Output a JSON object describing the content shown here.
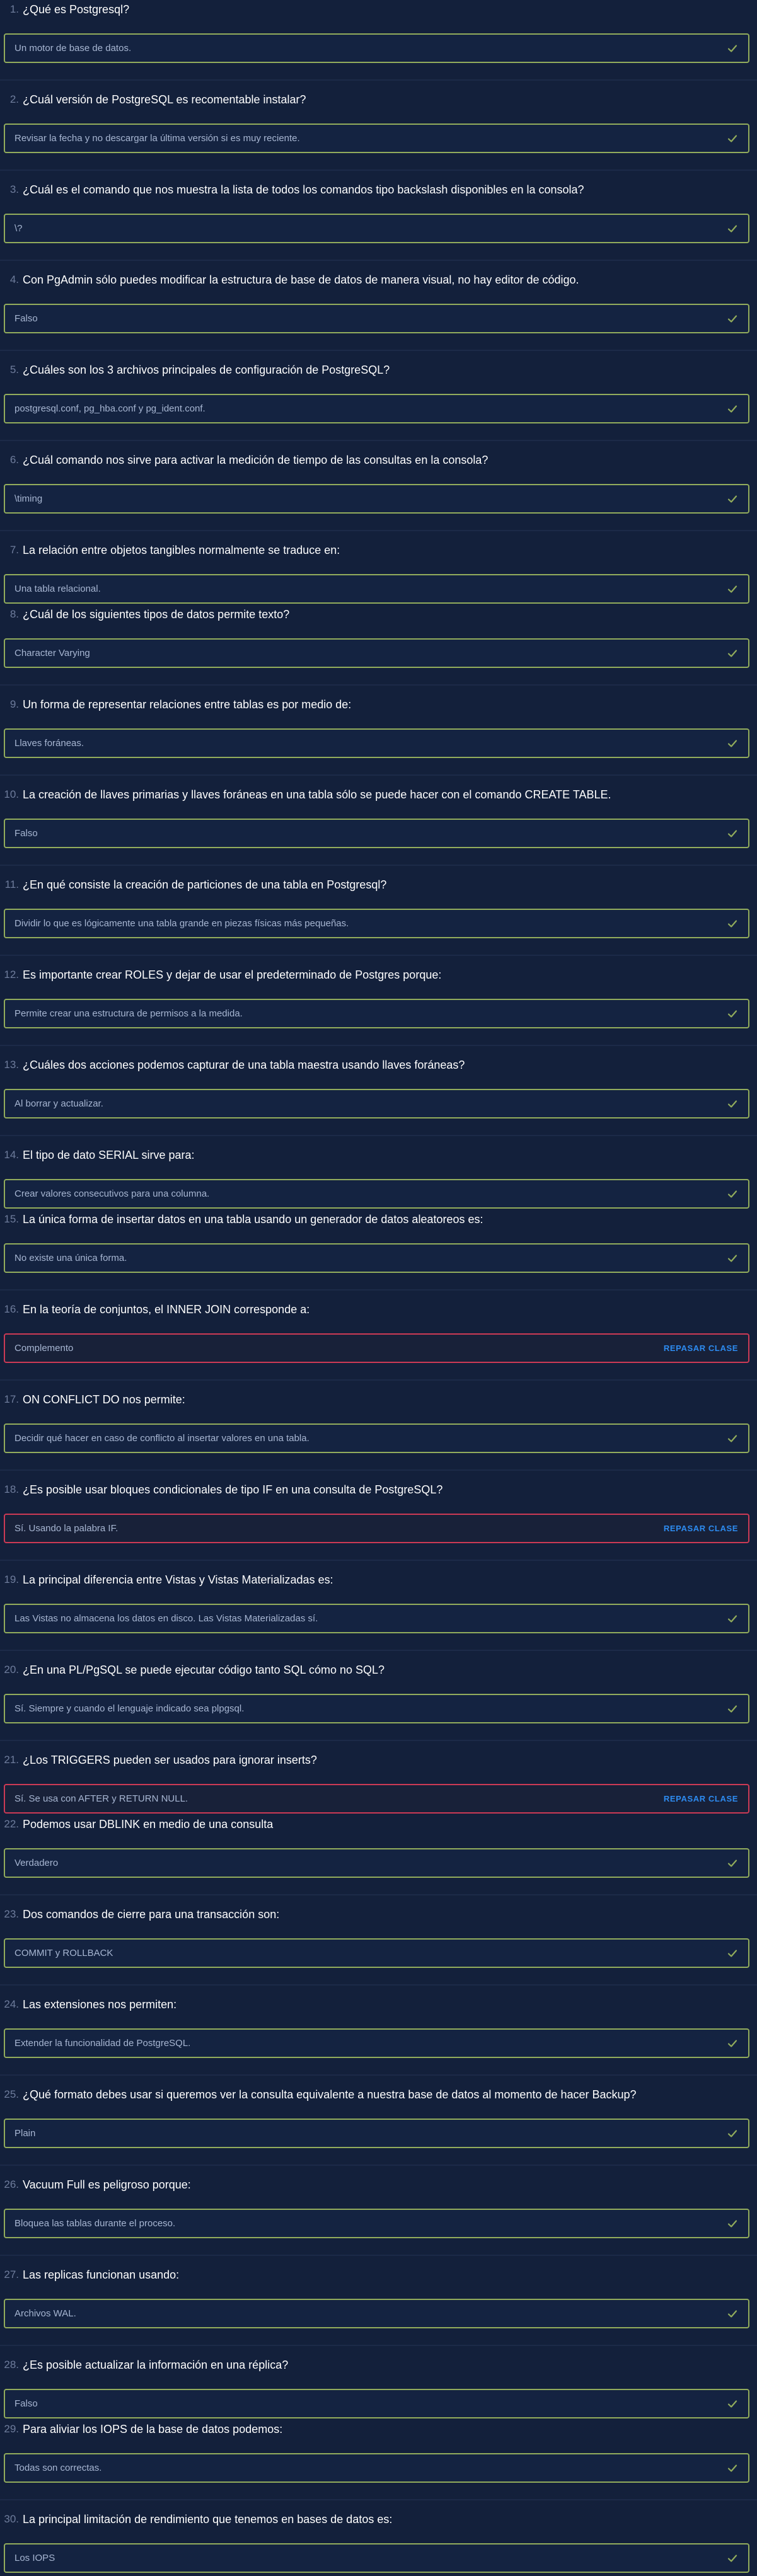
{
  "questions": [
    {
      "number": "1.",
      "question": "¿Qué es Postgresql?",
      "answer": "Un motor de base de datos.",
      "status": "correct"
    },
    {
      "number": "2.",
      "question": "¿Cuál versión de PostgreSQL es recomentable instalar?",
      "answer": "Revisar la fecha y no descargar la última versión si es muy reciente.",
      "status": "correct"
    },
    {
      "number": "3.",
      "question": "¿Cuál es el comando que nos muestra la lista de todos los comandos tipo backslash disponibles en la consola?",
      "answer": "\\?",
      "status": "correct"
    },
    {
      "number": "4.",
      "question": "Con PgAdmin sólo puedes modificar la estructura de base de datos de manera visual, no hay editor de código.",
      "answer": "Falso",
      "status": "correct"
    },
    {
      "number": "5.",
      "question": "¿Cuáles son los 3 archivos principales de configuración de PostgreSQL?",
      "answer": "postgresql.conf, pg_hba.conf y pg_ident.conf.",
      "status": "correct"
    },
    {
      "number": "6.",
      "question": "¿Cuál comando nos sirve para activar la medición de tiempo de las consultas en la consola?",
      "answer": "\\timing",
      "status": "correct"
    },
    {
      "number": "7.",
      "question": "La relación entre objetos tangibles normalmente se traduce en:",
      "answer": "Una tabla relacional.",
      "status": "correct"
    },
    {
      "number": "8.",
      "question": "¿Cuál de los siguientes tipos de datos permite texto?",
      "answer": "Character Varying",
      "status": "correct"
    },
    {
      "number": "9.",
      "question": "Un forma de representar relaciones entre tablas es por medio de:",
      "answer": "Llaves foráneas.",
      "status": "correct"
    },
    {
      "number": "10.",
      "question": "La creación de llaves primarias y llaves foráneas en una tabla sólo se puede hacer con el comando CREATE TABLE.",
      "answer": "Falso",
      "status": "correct"
    },
    {
      "number": "11.",
      "question": "¿En qué consiste la creación de particiones de una tabla en Postgresql?",
      "answer": "Dividir lo que es lógicamente una tabla grande en piezas físicas más pequeñas.",
      "status": "correct"
    },
    {
      "number": "12.",
      "question": "Es importante crear ROLES y dejar de usar el predeterminado de Postgres porque:",
      "answer": "Permite crear una estructura de permisos a la medida.",
      "status": "correct"
    },
    {
      "number": "13.",
      "question": "¿Cuáles dos acciones podemos capturar de una tabla maestra usando llaves foráneas?",
      "answer": "Al borrar y actualizar.",
      "status": "correct"
    },
    {
      "number": "14.",
      "question": "El tipo de dato SERIAL sirve para:",
      "answer": "Crear valores consecutivos para una columna.",
      "status": "correct"
    },
    {
      "number": "15.",
      "question": "La única forma de insertar datos en una tabla usando un generador de datos aleatoreos es:",
      "answer": "No existe una única forma.",
      "status": "correct"
    },
    {
      "number": "16.",
      "question": "En la teoría de conjuntos, el INNER JOIN corresponde a:",
      "answer": "Complemento",
      "status": "incorrect"
    },
    {
      "number": "17.",
      "question": "ON CONFLICT DO nos permite:",
      "answer": "Decidir qué hacer en caso de conflicto al insertar valores en una tabla.",
      "status": "correct"
    },
    {
      "number": "18.",
      "question": "¿Es posible usar bloques condicionales de tipo IF en una consulta de PostgreSQL?",
      "answer": "Sí. Usando la palabra IF.",
      "status": "incorrect"
    },
    {
      "number": "19.",
      "question": "La principal diferencia entre Vistas y Vistas Materializadas es:",
      "answer": "Las Vistas no almacena los datos en disco. Las Vistas Materializadas sí.",
      "status": "correct"
    },
    {
      "number": "20.",
      "question": "¿En una PL/PgSQL se puede ejecutar código tanto SQL cómo no SQL?",
      "answer": "Sí. Siempre y cuando el lenguaje indicado sea plpgsql.",
      "status": "correct"
    },
    {
      "number": "21.",
      "question": "¿Los TRIGGERS pueden ser usados para ignorar inserts?",
      "answer": "Sí. Se usa con AFTER y RETURN NULL.",
      "status": "incorrect"
    },
    {
      "number": "22.",
      "question": "Podemos usar DBLINK en medio de una consulta",
      "answer": "Verdadero",
      "status": "correct"
    },
    {
      "number": "23.",
      "question": "Dos comandos de cierre para una transacción son:",
      "answer": "COMMIT y ROLLBACK",
      "status": "correct"
    },
    {
      "number": "24.",
      "question": "Las extensiones nos permiten:",
      "answer": "Extender la funcionalidad de PostgreSQL.",
      "status": "correct"
    },
    {
      "number": "25.",
      "question": "¿Qué formato debes usar si queremos ver la consulta equivalente a nuestra base de datos al momento de hacer Backup?",
      "answer": "Plain",
      "status": "correct"
    },
    {
      "number": "26.",
      "question": "Vacuum Full es peligroso porque:",
      "answer": "Bloquea las tablas durante el proceso.",
      "status": "correct"
    },
    {
      "number": "27.",
      "question": "Las replicas funcionan usando:",
      "answer": "Archivos WAL.",
      "status": "correct"
    },
    {
      "number": "28.",
      "question": "¿Es posible actualizar la información en una réplica?",
      "answer": "Falso",
      "status": "correct"
    },
    {
      "number": "29.",
      "question": "Para aliviar los IOPS de la base de datos podemos:",
      "answer": "Todas son correctas.",
      "status": "correct"
    },
    {
      "number": "30.",
      "question": "La principal limitación de rendimiento que tenemos en bases de datos es:",
      "answer": "Los IOPS",
      "status": "correct"
    }
  ],
  "review_label": "REPASAR CLASE",
  "icons": {
    "correct": "check-icon",
    "incorrect": "none"
  },
  "colors": {
    "background": "#13203b",
    "correct_border": "#92ac5c",
    "incorrect_border": "#cc3a55",
    "review_link": "#2d8bf0"
  }
}
